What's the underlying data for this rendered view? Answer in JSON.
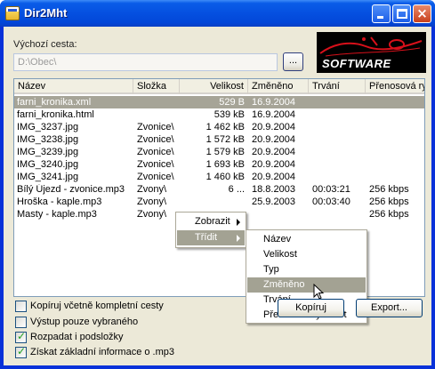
{
  "window": {
    "title": "Dir2Mht",
    "minimize_label": "",
    "maximize_label": "",
    "close_label": "×"
  },
  "path": {
    "label": "Výchozí cesta:",
    "value": "D:\\Obec\\",
    "browse_label": "..."
  },
  "logo": {
    "text": "SOFTWARE",
    "accent_color": "#d8101a"
  },
  "list": {
    "columns": [
      "Název",
      "Složka",
      "Velikost",
      "Změněno",
      "Trvání",
      "Přenosová rychlost"
    ],
    "rows": [
      {
        "name": "farni_kronika.xml",
        "folder": "",
        "size": "529 B",
        "modified": "16.9.2004",
        "duration": "",
        "bitrate": "",
        "selected": true
      },
      {
        "name": "farni_kronika.html",
        "folder": "",
        "size": "539 kB",
        "modified": "16.9.2004",
        "duration": "",
        "bitrate": ""
      },
      {
        "name": "IMG_3237.jpg",
        "folder": "Zvonice\\",
        "size": "1 462 kB",
        "modified": "20.9.2004",
        "duration": "",
        "bitrate": ""
      },
      {
        "name": "IMG_3238.jpg",
        "folder": "Zvonice\\",
        "size": "1 572 kB",
        "modified": "20.9.2004",
        "duration": "",
        "bitrate": ""
      },
      {
        "name": "IMG_3239.jpg",
        "folder": "Zvonice\\",
        "size": "1 579 kB",
        "modified": "20.9.2004",
        "duration": "",
        "bitrate": ""
      },
      {
        "name": "IMG_3240.jpg",
        "folder": "Zvonice\\",
        "size": "1 693 kB",
        "modified": "20.9.2004",
        "duration": "",
        "bitrate": ""
      },
      {
        "name": "IMG_3241.jpg",
        "folder": "Zvonice\\",
        "size": "1 460 kB",
        "modified": "20.9.2004",
        "duration": "",
        "bitrate": ""
      },
      {
        "name": "Bílý Újezd - zvonice.mp3",
        "folder": "Zvony\\",
        "size": "6 ...",
        "modified": "18.8.2003",
        "duration": "00:03:21",
        "bitrate": "256 kbps"
      },
      {
        "name": "Hroška - kaple.mp3",
        "folder": "Zvony\\",
        "size": "",
        "modified": "25.9.2003",
        "duration": "00:03:40",
        "bitrate": "256 kbps"
      },
      {
        "name": "Masty - kaple.mp3",
        "folder": "Zvony\\",
        "size": "",
        "modified": "",
        "duration": "",
        "bitrate": "256 kbps"
      }
    ]
  },
  "context_menu": {
    "items": [
      {
        "label": "Zobrazit",
        "highlighted": false
      },
      {
        "label": "Třídit",
        "highlighted": true
      }
    ],
    "submenu": [
      {
        "label": "Název",
        "highlighted": false
      },
      {
        "label": "Velikost",
        "highlighted": false
      },
      {
        "label": "Typ",
        "highlighted": false
      },
      {
        "label": "Změněno",
        "highlighted": true
      },
      {
        "label": "Trvání",
        "highlighted": false
      },
      {
        "label": "Přenosová rychlost",
        "highlighted": false
      }
    ]
  },
  "options": [
    {
      "label": "Kopíruj včetně kompletní cesty",
      "checked": false
    },
    {
      "label": "Výstup pouze vybraného",
      "checked": false
    },
    {
      "label": "Rozpadat i podsložky",
      "checked": true
    },
    {
      "label": "Získat základní informace o .mp3",
      "checked": true
    }
  ],
  "buttons": {
    "copy_label": "Kopíruj",
    "export_label": "Export..."
  },
  "colors": {
    "titlebar": "#0550e0",
    "selection": "#a6a497",
    "dialog_face": "#ece9d8"
  }
}
